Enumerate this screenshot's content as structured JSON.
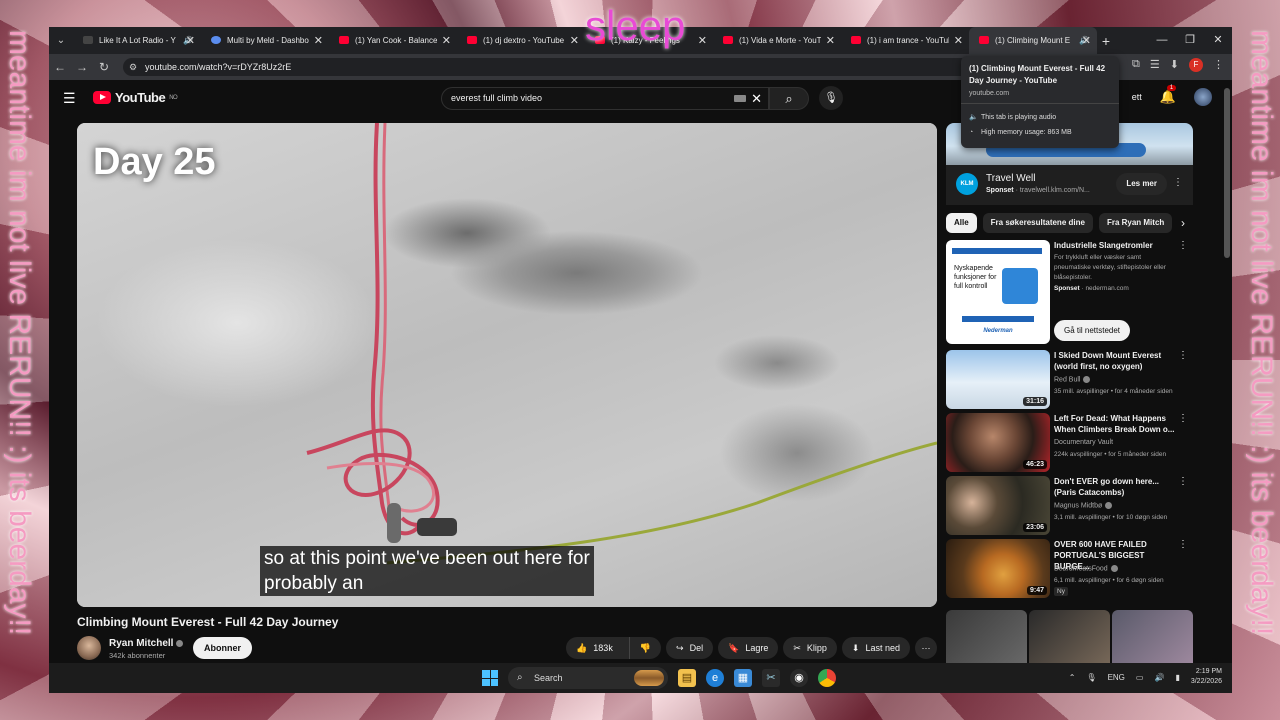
{
  "overlay": {
    "title": "sleep",
    "left_text": "meantime im not live RERUN!! :) its beerday!!",
    "right_text": "meantime im not live RERUN!! :) its beerday!!"
  },
  "browser": {
    "tabs": [
      {
        "title": "Like It A Lot Radio - Y",
        "icon": "dark-favicon",
        "audio": true
      },
      {
        "title": "Multi by Meld - Dashboar",
        "icon": "meld-favicon",
        "audio": false
      },
      {
        "title": "(1) Yan Cook - Balance - Y",
        "icon": "youtube-favicon",
        "audio": false
      },
      {
        "title": "(1) dj dextro - YouTube",
        "icon": "youtube-favicon",
        "audio": false
      },
      {
        "title": "(1) Kaizy - Feelings",
        "icon": "youtube-favicon",
        "audio": false
      },
      {
        "title": "(1) Vida e Morte - YouTub",
        "icon": "youtube-favicon",
        "audio": false
      },
      {
        "title": "(1) i am trance - YouTube",
        "icon": "youtube-favicon",
        "audio": false
      },
      {
        "title": "(1) Climbing Mount E",
        "icon": "youtube-favicon",
        "audio": true,
        "active": true
      }
    ],
    "url": "youtube.com/watch?v=rDYZr8Uz2rE",
    "tab_hover": {
      "title": "(1) Climbing Mount Everest - Full 42 Day Journey - YouTube",
      "host": "youtube.com",
      "audio_note": "This tab is playing audio",
      "memory_note": "High memory usage: 863 MB"
    }
  },
  "youtube": {
    "logo_text": "YouTube",
    "logo_region": "NO",
    "search_query": "everest full climb video",
    "header_right_text": "ett",
    "notification_count": "1",
    "video": {
      "day_label": "Day 25",
      "caption_line1": "so at this point we've been out here for",
      "caption_line2": "probably an",
      "title": "Climbing Mount Everest - Full 42 Day Journey"
    },
    "channel": {
      "name": "Ryan Mitchell",
      "subscribers": "342k abonnenter",
      "subscribe_label": "Abonner"
    },
    "actions": {
      "likes": "183k",
      "share": "Del",
      "save": "Lagre",
      "clip": "Klipp",
      "download": "Last ned"
    },
    "ad": {
      "title": "Travel Well",
      "sponsored": "Sponset",
      "domain": "travelwell.klm.com/N...",
      "button": "Les mer",
      "logo": "KLM"
    },
    "chips": [
      "Alle",
      "Fra søkeresultatene dine",
      "Fra Ryan Mitch"
    ],
    "ad_card": {
      "title": "Industrielle Slangetromler",
      "description": "For trykkluft eller væsker samt pneumatiske verktøy, stiftepistoler eller blåsepistoler.",
      "sponsored": "Sponset",
      "domain": "nederman.com",
      "button": "Gå til nettstedet",
      "image_text": "Nyskapende funksjoner for full kontroll",
      "image_logo": "Nederman"
    },
    "recommendations": [
      {
        "title": "I Skied Down Mount Everest (world first, no oxygen)",
        "channel": "Red Bull",
        "meta": "35 mill. avspillinger • for 4 måneder siden",
        "duration": "31:16",
        "verified": true
      },
      {
        "title": "Left For Dead: What Happens When Climbers Break Down o...",
        "channel": "Documentary Vault",
        "meta": "224k avspillinger • for 5 måneder siden",
        "duration": "46:23",
        "verified": false
      },
      {
        "title": "Don't EVER go down here... (Paris Catacombs)",
        "channel": "Magnus Midtbø",
        "meta": "3,1 mill. avspillinger • for 10 døgn siden",
        "duration": "23:06",
        "verified": true
      },
      {
        "title": "OVER 600 HAVE FAILED PORTUGAL'S BIGGEST BURGE...",
        "channel": "BeardMeatsFood",
        "meta": "6,1 mill. avspillinger • for 6 døgn siden",
        "duration": "9:47",
        "verified": true,
        "badge": "Ny"
      }
    ]
  },
  "taskbar": {
    "search_label": "Search",
    "language": "ENG",
    "time": "2:19 PM",
    "date": "3/22/2026"
  }
}
